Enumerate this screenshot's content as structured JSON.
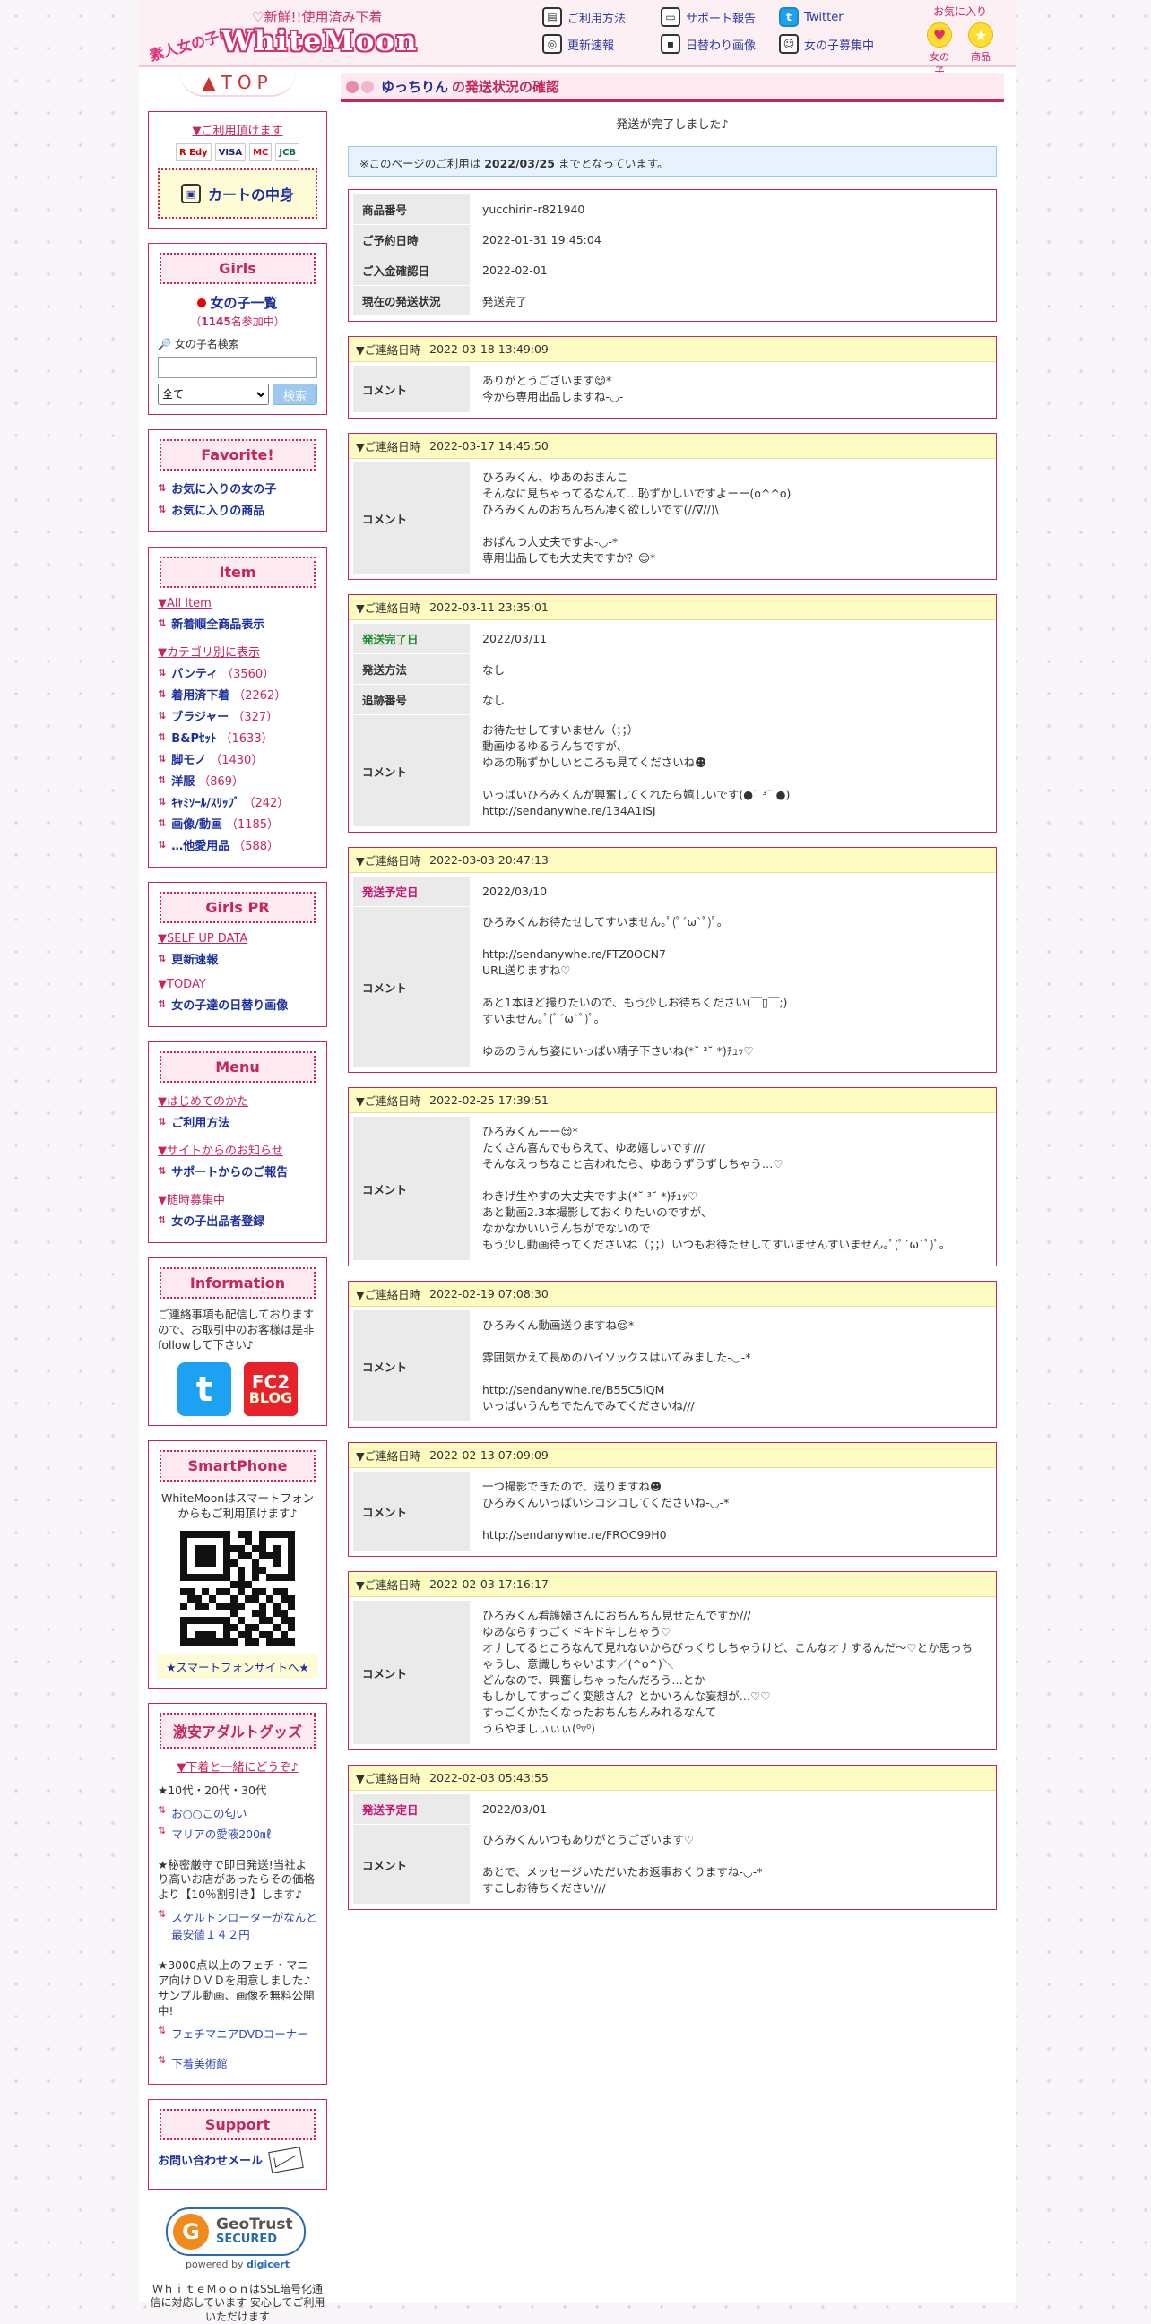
{
  "header": {
    "tagline": "新鮮!!使用済み下着",
    "logo_jp": "素人女の子の",
    "logo_brand": "WhiteMoon",
    "nav": [
      {
        "label": "ご利用方法",
        "icon": "book-icon"
      },
      {
        "label": "サポート報告",
        "icon": "laptop-icon"
      },
      {
        "label": "Twitter",
        "icon": "twitter-icon"
      },
      {
        "label": "更新速報",
        "icon": "camera-icon"
      },
      {
        "label": "日替わり画像",
        "icon": "floppy-icon"
      },
      {
        "label": "女の子募集中",
        "icon": "person-icon"
      }
    ],
    "favorites": {
      "title": "お気に入り",
      "girls": "女の子",
      "items": "商品"
    }
  },
  "sidebar": {
    "top_label": "▲TOP",
    "payment": {
      "title": "▼ご利用頂けます",
      "logos": [
        "R Edy",
        "VISA",
        "MC",
        "JCB"
      ],
      "cart_label": "カートの中身"
    },
    "girls": {
      "title": "Girls",
      "list_link": "女の子一覧",
      "count_prefix": "（",
      "count": "1145",
      "count_suffix": "名参加中）",
      "search_label": "女の子名検索",
      "select_value": "全て",
      "search_button": "検索"
    },
    "favorite": {
      "title": "Favorite!",
      "links": [
        "お気に入りの女の子",
        "お気に入りの商品"
      ]
    },
    "item": {
      "title": "Item",
      "all_label": "▼All Item",
      "new_arrivals": "新着順全商品表示",
      "category_label": "▼カテゴリ別に表示",
      "categories": [
        {
          "name": "パンティ",
          "count": "（3560）"
        },
        {
          "name": "着用済下着",
          "count": "（2262）"
        },
        {
          "name": "ブラジャー",
          "count": "（327）"
        },
        {
          "name": "B&Pｾｯﾄ",
          "count": "（1633）"
        },
        {
          "name": "脚モノ",
          "count": "（1430）"
        },
        {
          "name": "洋服",
          "count": "（869）"
        },
        {
          "name": "ｷｬﾐｿｰﾙ/ｽﾘｯﾌﾟ",
          "count": "（242）"
        },
        {
          "name": "画像/動画",
          "count": "（1185）"
        },
        {
          "name": "…他愛用品",
          "count": "（588）"
        }
      ]
    },
    "girls_pr": {
      "title": "Girls PR",
      "sections": [
        {
          "head": "▼SELF UP DATA",
          "link": "更新速報"
        },
        {
          "head": "▼TODAY",
          "link": "女の子達の日替り画像"
        }
      ]
    },
    "menu": {
      "title": "Menu",
      "sections": [
        {
          "head": "▼はじめてのかた",
          "link": "ご利用方法"
        },
        {
          "head": "▼サイトからのお知らせ",
          "link": "サポートからのご報告"
        },
        {
          "head": "▼随時募集中",
          "link": "女の子出品者登録"
        }
      ]
    },
    "information": {
      "title": "Information",
      "text": "ご連絡事項も配信しておりますので、お取引中のお客様は是非followして下さい♪",
      "twitter_glyph": "t",
      "fc2_top": "FC2",
      "fc2_bottom": "BLOG"
    },
    "smartphone": {
      "title": "SmartPhone",
      "text": "WhiteMoonはスマートフォンからもご利用頂けます♪",
      "link": "★スマートフォンサイトへ★"
    },
    "adult": {
      "title": "激安アダルトグッズ",
      "sub": "▼下着と一緒にどうぞ♪",
      "p1": "★10代・20代・30代",
      "links1": [
        "お○○この匂い",
        "マリアの愛液200㎖"
      ],
      "p2": "★秘密厳守で即日発送!当社より高いお店があったらその価格より【10％割引き】します♪",
      "links2": [
        "スケルトンローターがなんと最安値１４２円"
      ],
      "p3": "★3000点以上のフェチ・マニア向けＤＶＤを用意しました♪サンプル動画、画像を無料公開中!",
      "links3": [
        "フェチマニアDVDコーナー",
        "下着美術館"
      ]
    },
    "support": {
      "title": "Support",
      "link": "お問い合わせメール"
    },
    "geotrust": {
      "g": "G",
      "line1": "GeoTrust",
      "line2": "SECURED",
      "powered": "powered by ",
      "digicert": "digicert"
    },
    "ssl_text": "ＷｈｉｔｅＭｏｏｎはSSL暗号化通信に対応しています 安心してご利用いただけます"
  },
  "main": {
    "title_name": "ゆっちりん",
    "title_rest": "の発送状況の確認",
    "done_message": "発送が完了しました♪",
    "notice_prefix": "※このページのご利用は ",
    "notice_date": "2022/03/25",
    "notice_suffix": " までとなっています。",
    "info": [
      {
        "label": "商品番号",
        "value": "yucchirin-r821940"
      },
      {
        "label": "ご予約日時",
        "value": "2022-01-31 19:45:04"
      },
      {
        "label": "ご入金確認日",
        "value": "2022-02-01"
      },
      {
        "label": "現在の発送状況",
        "value": "発送完了"
      }
    ],
    "contact_label": "▼ご連絡日時",
    "comment_label": "コメント",
    "comments": [
      {
        "date": "2022-03-18 13:49:09",
        "rows": [],
        "text": "ありがとうございます😌*\n今から専用出品しますね-◡-"
      },
      {
        "date": "2022-03-17 14:45:50",
        "rows": [],
        "text": "ひろみくん、ゆあのおまんこ\nそんなに見ちゃってるなんて…恥ずかしいですよーー(o^^o)\nひろみくんのおちんちん凄く欲しいです(//∇//)\\\n\nおぱんつ大丈夫ですよ-◡-*\n専用出品しても大丈夫ですか？😌*"
      },
      {
        "date": "2022-03-11 23:35:01",
        "rows": [
          {
            "label": "発送完了日",
            "value": "2022/03/11",
            "color": "green"
          },
          {
            "label": "発送方法",
            "value": "なし"
          },
          {
            "label": "追跡番号",
            "value": "なし"
          }
        ],
        "text": "お待たせしてすいません（；；）\n動画ゆるゆるうんちですが、\nゆあの恥ずかしいところも見てくださいね☻\n\nいっぱいひろみくんが興奮してくれたら嬉しいです(●˘ ³˘ ●)\nhttp://sendanywhe.re/134A1ISJ"
      },
      {
        "date": "2022-03-03 20:47:13",
        "rows": [
          {
            "label": "発送予定日",
            "value": "2022/03/10",
            "color": "pink"
          }
        ],
        "text": "ひろみくんお待たせしてすいません｡ﾟ(ﾟ´ω`ﾟ)ﾟ｡\n\nhttp://sendanywhe.re/FTZ0OCN7\nURL送りますね♡\n\nあと1本ほど撮りたいので、もう少しお待ちください(￣▯￣;)\nすいません｡ﾟ(ﾟ´ω`ﾟ)ﾟ｡\n\nゆあのうんち姿にいっぱい精子下さいね(*˘ ³˘ *)ﾁｭｯ♡"
      },
      {
        "date": "2022-02-25 17:39:51",
        "rows": [],
        "text": "ひろみくんーー😌*\nたくさん喜んでもらえて、ゆあ嬉しいです///\nそんなえっちなこと言われたら、ゆあうずうずしちゃう…♡\n\nわきげ生やすの大丈夫ですよ(*˘ ³˘ *)ﾁｭｯ♡\nあと動画2.3本撮影しておくりたいのですが、\nなかなかいいうんちがでないので\nもう少し動画待ってくださいね（；；）いつもお待たせしてすいませんすいません｡ﾟ(ﾟ´ω`ﾟ)ﾟ｡"
      },
      {
        "date": "2022-02-19 07:08:30",
        "rows": [],
        "text": "ひろみくん動画送りますね😌*\n\n雰囲気かえて長めのハイソックスはいてみました-◡-*\n\nhttp://sendanywhe.re/B55C5IQM\nいっぱいうんちでたんでみてくださいね///"
      },
      {
        "date": "2022-02-13 07:09:09",
        "rows": [],
        "text": "一つ撮影できたので、送りますね☻\nひろみくんいっぱいシコシコしてくださいね-◡-*\n\nhttp://sendanywhe.re/FROC99H0"
      },
      {
        "date": "2022-02-03 17:16:17",
        "rows": [],
        "text": "ひろみくん看護婦さんにおちんちん見せたんですか///\nゆあならすっごくドキドキしちゃう♡\nオナしてるところなんて見れないからびっくりしちゃうけど、こんなオナするんだ〜♡とか思っちゃうし、意識しちゃいます／(^o^)＼\nどんなので、興奮しちゃったんだろう…とか\nもしかしてすっごく変態さん？とかいろんな妄想が…♡♡\nすっごくかたくなったおちんちんみれるなんて\nうらやましぃぃぃ(⁰▿⁰)"
      },
      {
        "date": "2022-02-03 05:43:55",
        "rows": [
          {
            "label": "発送予定日",
            "value": "2022/03/01",
            "color": "pink"
          }
        ],
        "text": "ひろみくんいつもありがとうございます♡\n\nあとで、メッセージいただいたお返事おくりますね-◡-*\nすこしお待ちください///"
      }
    ]
  },
  "colors": {
    "accent": "#c8245e",
    "link": "#1c2fa0",
    "comment_head": "#fefcc0",
    "notice_bg": "#e8f2fc"
  }
}
